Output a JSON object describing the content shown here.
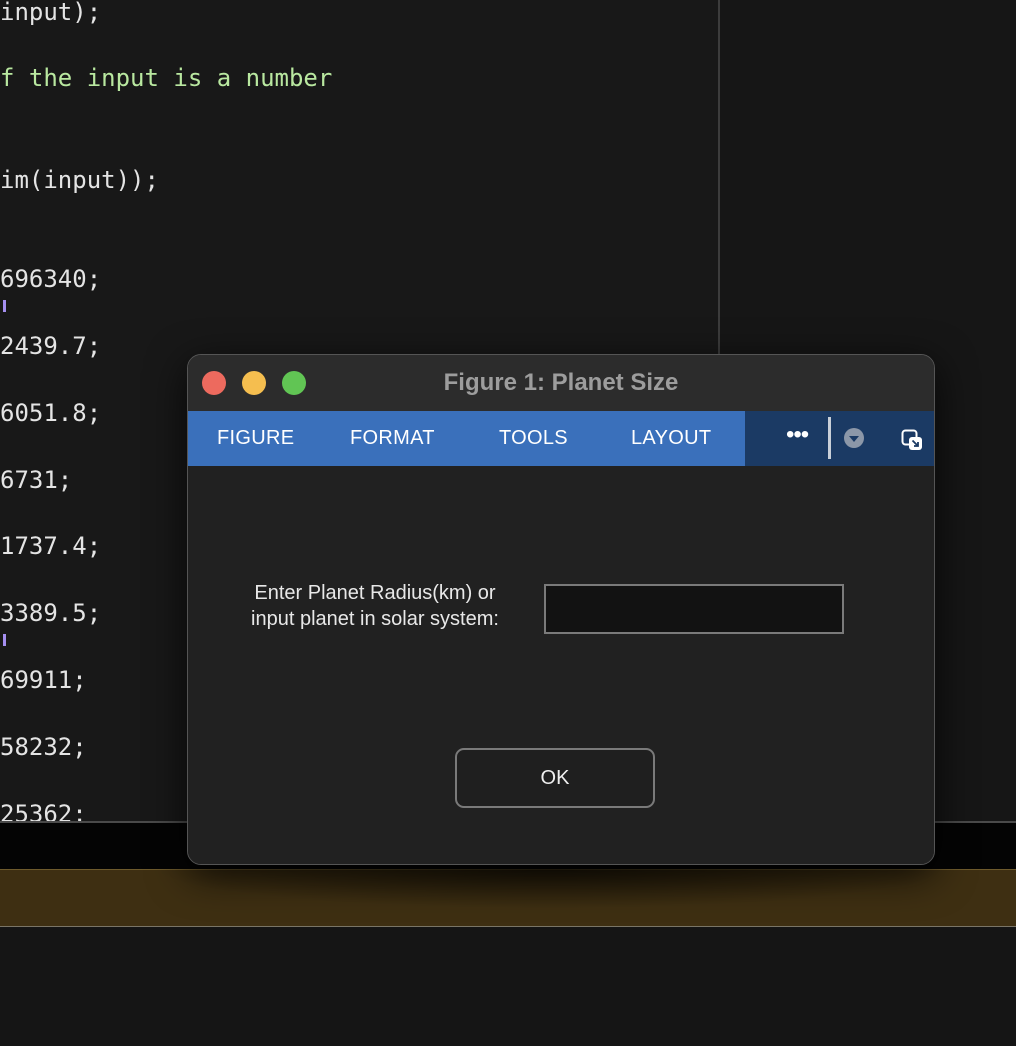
{
  "editor": {
    "lines": [
      "input);",
      "f the input is a number",
      "im(input));",
      "696340;",
      "2439.7;",
      "6051.8;",
      "6731;",
      "1737.4;",
      "3389.5;",
      "69911;",
      "58232;",
      "25362;"
    ]
  },
  "dialog": {
    "title": "Figure 1: Planet Size",
    "tabs": [
      "FIGURE",
      "FORMAT",
      "TOOLS",
      "LAYOUT"
    ],
    "more_label": "•••",
    "prompt_line1": "Enter Planet Radius(km) or",
    "prompt_line2": "input planet in solar system:",
    "input_value": "",
    "ok_label": "OK"
  },
  "colors": {
    "toolstrip_tabs": "#3a70bb",
    "toolstrip_dark": "#1b3a64",
    "traffic_close": "#ed6a5e",
    "traffic_minimize": "#f5be4f",
    "traffic_maximize": "#61c554",
    "code_comment": "#b9e8a0"
  },
  "icons": {
    "more": "more-options-icon",
    "collapse": "collapse-toolstrip-icon",
    "undock": "undock-icon"
  }
}
